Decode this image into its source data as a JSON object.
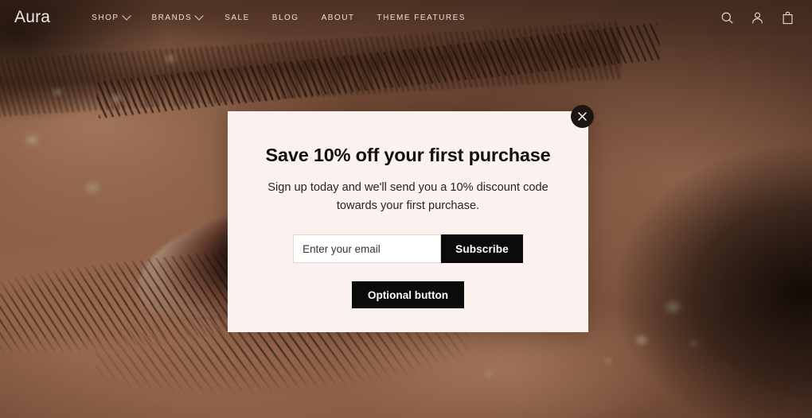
{
  "site": {
    "logo": "Aura",
    "nav": [
      {
        "label": "SHOP",
        "has_dropdown": true
      },
      {
        "label": "BRANDS",
        "has_dropdown": true
      },
      {
        "label": "SALE",
        "has_dropdown": false
      },
      {
        "label": "BLOG",
        "has_dropdown": false
      },
      {
        "label": "ABOUT",
        "has_dropdown": false
      },
      {
        "label": "THEME FEATURES",
        "has_dropdown": false
      }
    ],
    "icons": [
      {
        "name": "search-icon"
      },
      {
        "name": "account-icon"
      },
      {
        "name": "cart-icon"
      }
    ]
  },
  "background": {
    "description": "macro photograph of an eye with eyebrow and lashes",
    "skin_tone": "#8a5e45",
    "shadow": "#1a0f09"
  },
  "modal": {
    "heading": "Save 10% off your first purchase",
    "body": "Sign up today and we'll send you a 10% discount code towards your first purchase.",
    "email_placeholder": "Enter your email",
    "email_value": "",
    "subscribe_label": "Subscribe",
    "optional_label": "Optional button",
    "close_icon": "close-icon",
    "background_color": "#faf2ef",
    "button_color": "#0b0b0b"
  }
}
